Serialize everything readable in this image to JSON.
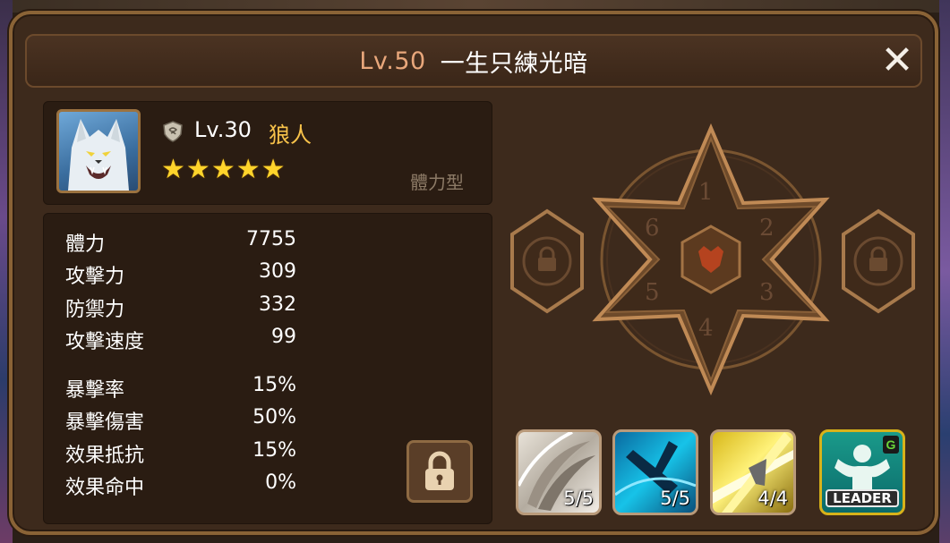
{
  "header": {
    "level": "Lv.50",
    "name": "一生只練光暗"
  },
  "monster": {
    "level": "Lv.30",
    "name": "狼人",
    "stars": 5,
    "type": "體力型",
    "attribute_icon": "wind-attribute-icon"
  },
  "stats": {
    "primary": [
      {
        "label": "體力",
        "value": "7755"
      },
      {
        "label": "攻擊力",
        "value": "309"
      },
      {
        "label": "防禦力",
        "value": "332"
      },
      {
        "label": "攻擊速度",
        "value": "99"
      }
    ],
    "secondary": [
      {
        "label": "暴擊率",
        "value": "15%"
      },
      {
        "label": "暴擊傷害",
        "value": "50%"
      },
      {
        "label": "效果抵抗",
        "value": "15%"
      },
      {
        "label": "效果命中",
        "value": "0%"
      }
    ]
  },
  "runes": {
    "slots": [
      "1",
      "2",
      "3",
      "4",
      "5",
      "6"
    ]
  },
  "skills": [
    {
      "level": "5/5",
      "icon": "claw-slash-icon"
    },
    {
      "level": "5/5",
      "icon": "ice-fang-icon"
    },
    {
      "level": "4/4",
      "icon": "lightning-rush-icon"
    },
    {
      "leader_label": "LEADER",
      "icon": "leader-skill-icon"
    }
  ],
  "colors": {
    "accent_gold": "#f7c24a",
    "title_level": "#e9a77b",
    "frame": "#8a6336"
  }
}
